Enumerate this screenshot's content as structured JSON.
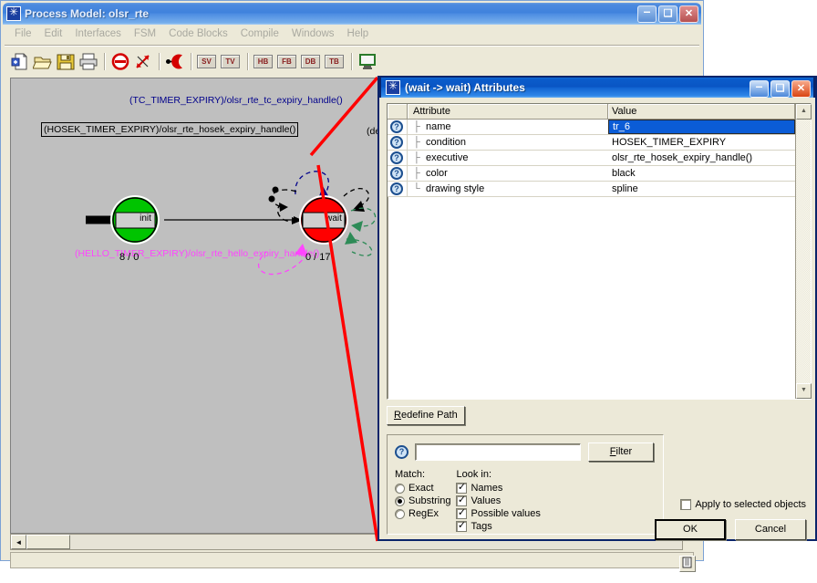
{
  "main_window": {
    "title": "Process Model: olsr_rte",
    "title_icon": "opnet-star-icon",
    "menu": [
      "File",
      "Edit",
      "Interfaces",
      "FSM",
      "Code Blocks",
      "Compile",
      "Windows",
      "Help"
    ],
    "toolbar": {
      "icons": [
        "new-document-icon",
        "open-folder-icon",
        "save-disk-icon",
        "print-icon",
        "stop-icon",
        "arrows-expand-icon",
        "transition-icon"
      ],
      "label_buttons": [
        "SV",
        "TV",
        "HB",
        "FB",
        "DB",
        "TB"
      ],
      "last_icon": "screen-icon"
    },
    "window_buttons": {
      "minimize": "–",
      "maximize": "❑",
      "close": "✕"
    },
    "scrollbar": {
      "left_arrow": "◄"
    },
    "resize_grip_icon": "resize-grip-icon"
  },
  "fsm": {
    "states": [
      {
        "id": "init",
        "label": "init",
        "color": "#00c400",
        "counter": "8 / 0"
      },
      {
        "id": "wait",
        "label": "wait",
        "color": "#ff0000",
        "counter": "0 / 17"
      }
    ],
    "transition_labels": [
      {
        "text": "(TC_TIMER_EXPIRY)/olsr_rte_tc_expiry_handle()",
        "color": "#00008b"
      },
      {
        "text": "(HOSEK_TIMER_EXPIRY)/olsr_rte_hosek_expiry_handle()",
        "color": "#000000",
        "boxed": true
      },
      {
        "text": "(HELLO_TIMER_EXPIRY)/olsr_rte_hello_expiry_handle()",
        "color": "#ff00ff"
      },
      {
        "text": "(def",
        "color": "#000000",
        "clipped": true
      }
    ],
    "colors": {
      "canvas": "#bfbfbf",
      "callout": "#ff0000",
      "init_state": "#00c400",
      "wait_state": "#ff0000"
    }
  },
  "dialog": {
    "title": "(wait -> wait) Attributes",
    "title_icon": "opnet-star-icon",
    "window_buttons": {
      "minimize": "–",
      "maximize": "❑",
      "close": "✕"
    },
    "table": {
      "columns": [
        "Attribute",
        "Value"
      ],
      "rows": [
        {
          "icon": "help-question-icon",
          "attribute": "name",
          "value": "tr_6",
          "selected": true
        },
        {
          "icon": "help-question-icon",
          "attribute": "condition",
          "value": "HOSEK_TIMER_EXPIRY",
          "selected": false
        },
        {
          "icon": "help-question-icon",
          "attribute": "executive",
          "value": "olsr_rte_hosek_expiry_handle()",
          "selected": false
        },
        {
          "icon": "help-question-icon",
          "attribute": "color",
          "value": "black",
          "selected": false
        },
        {
          "icon": "help-question-icon",
          "attribute": "drawing style",
          "value": "spline",
          "selected": false
        }
      ],
      "scroll_up": "▲",
      "scroll_down": "▼"
    },
    "redefine_path_label": "Redefine Path",
    "filter": {
      "help_icon": "help-question-icon",
      "input_value": "",
      "input_placeholder": "",
      "filter_button": "Filter",
      "match_label": "Match:",
      "match_options": [
        {
          "label": "Exact",
          "selected": false
        },
        {
          "label": "Substring",
          "selected": true
        },
        {
          "label": "RegEx",
          "selected": false
        }
      ],
      "lookin_label": "Look in:",
      "lookin_options": [
        {
          "label": "Names",
          "checked": true
        },
        {
          "label": "Values",
          "checked": true
        },
        {
          "label": "Possible values",
          "checked": true
        },
        {
          "label": "Tags",
          "checked": true
        }
      ]
    },
    "apply_to_selected": {
      "label": "Apply to selected objects",
      "checked": false
    },
    "buttons": {
      "ok": "OK",
      "cancel": "Cancel"
    }
  }
}
